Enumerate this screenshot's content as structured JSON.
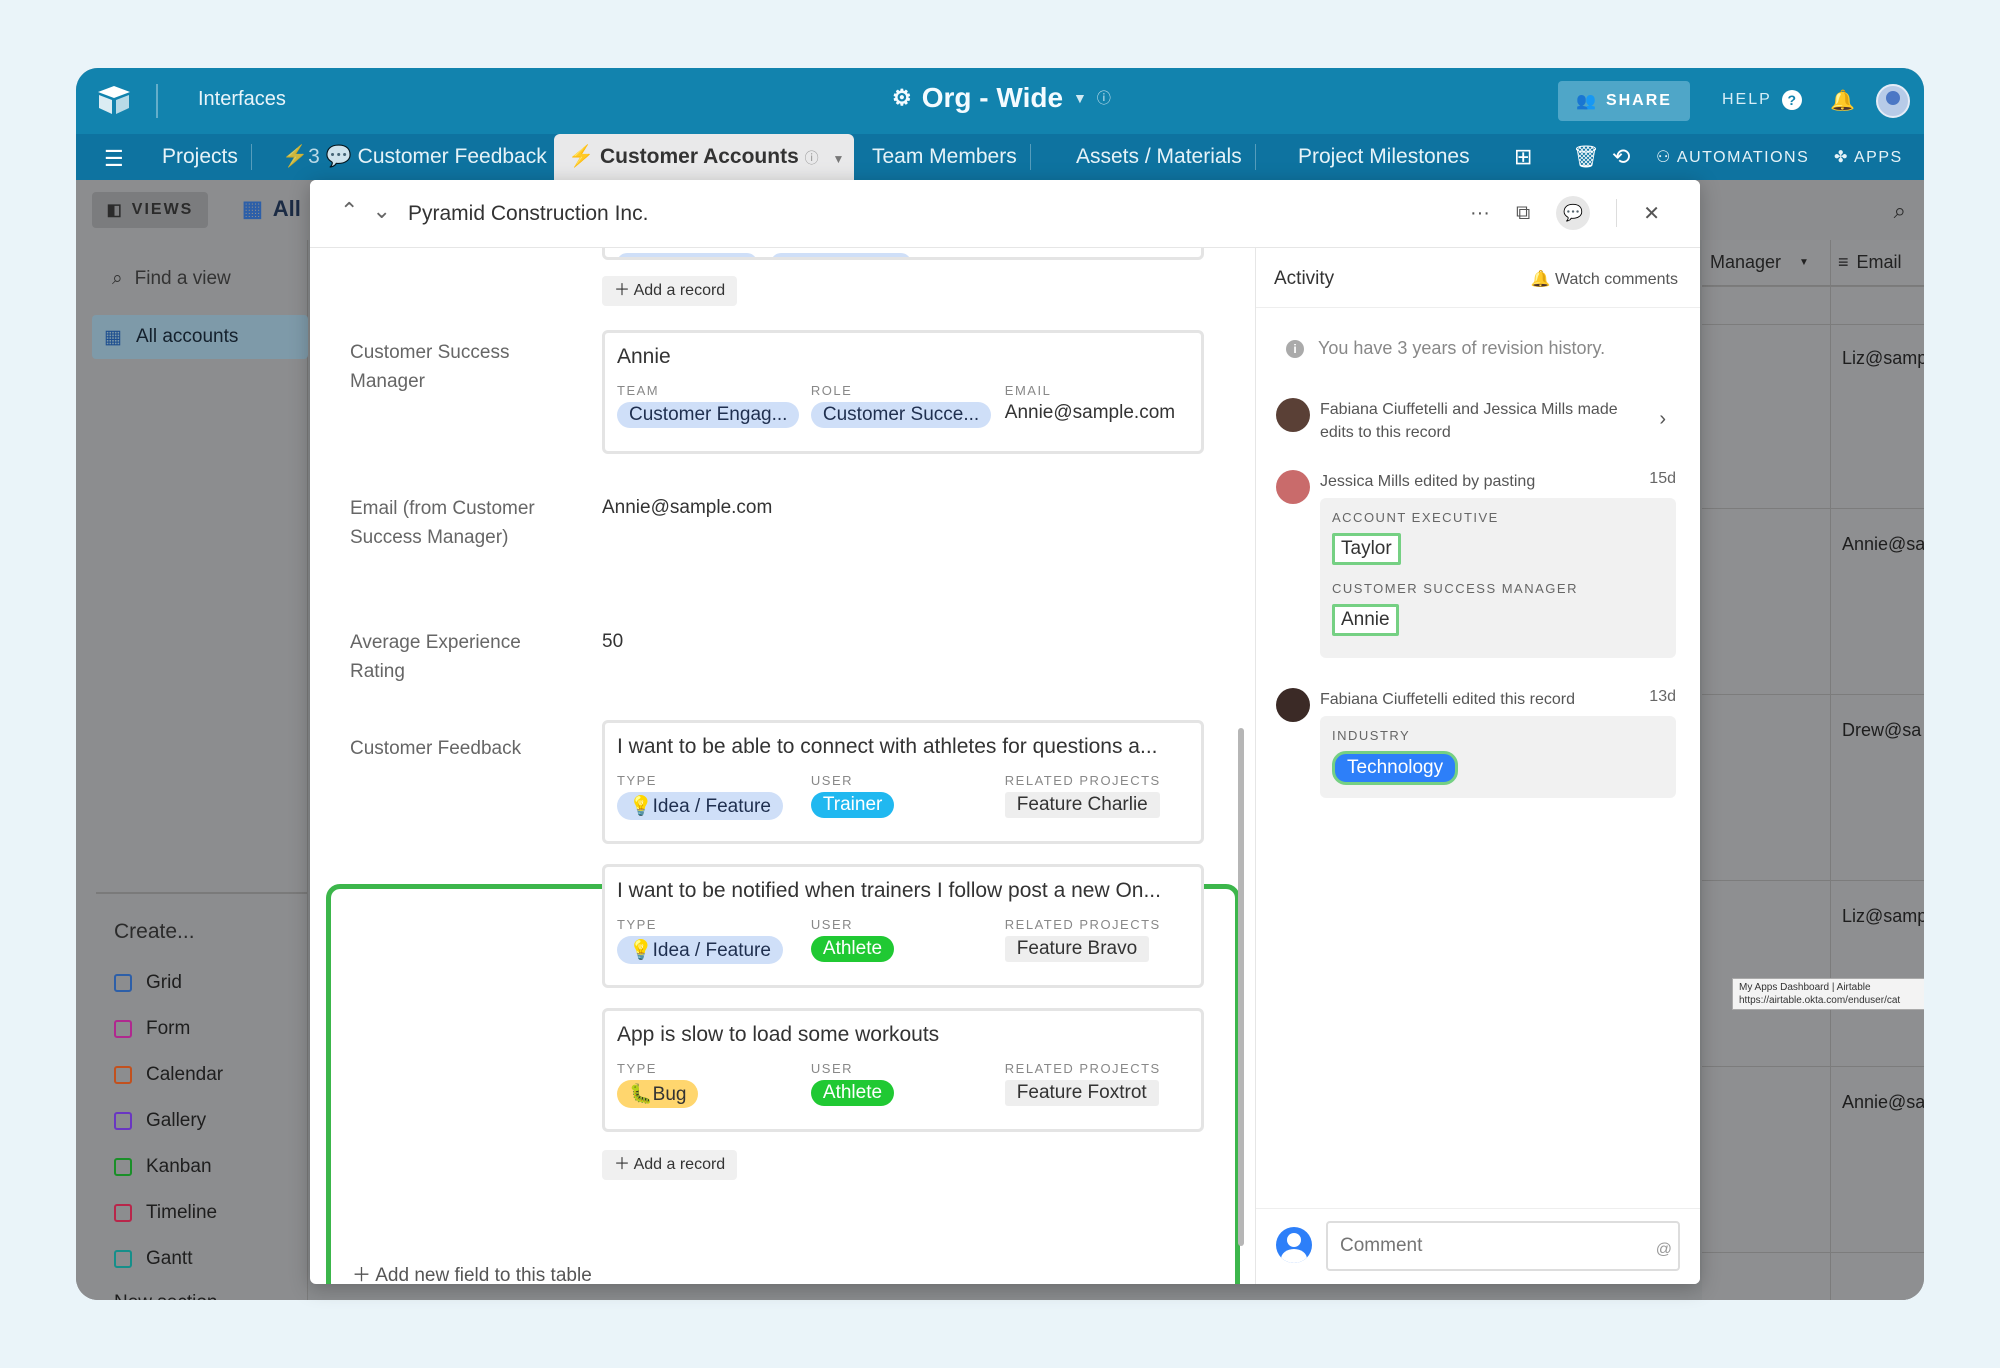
{
  "topbar": {
    "interfaces": "Interfaces",
    "base_name": "Org - Wide",
    "share": "SHARE",
    "help": "HELP"
  },
  "tabs": [
    {
      "label": "Projects"
    },
    {
      "label": "Customer Feedback",
      "prefix": "⚡3 💬"
    },
    {
      "label": "Customer Accounts"
    },
    {
      "label": "Team Members"
    },
    {
      "label": "Assets / Materials"
    },
    {
      "label": "Project Milestones"
    }
  ],
  "tabbar_right": {
    "automations": "AUTOMATIONS",
    "apps": "APPS"
  },
  "viewsbar": {
    "views": "VIEWS",
    "current_view_short": "All"
  },
  "sidebar": {
    "find_placeholder": "Find a view",
    "active_view": "All accounts",
    "create_label": "Create...",
    "create_items": [
      {
        "label": "Grid",
        "color": "#2d7ff9"
      },
      {
        "label": "Form",
        "color": "#e929ba"
      },
      {
        "label": "Calendar",
        "color": "#ff6f2c"
      },
      {
        "label": "Gallery",
        "color": "#8b46ff"
      },
      {
        "label": "Kanban",
        "color": "#20c933"
      },
      {
        "label": "Timeline",
        "color": "#f82b60"
      },
      {
        "label": "Gantt",
        "color": "#20d9d2"
      }
    ],
    "new_section": "New section"
  },
  "grid": {
    "col_manager": "Manager",
    "col_email": "Email",
    "emails": [
      "Liz@samp",
      "Annie@sa",
      "Drew@sa",
      "Liz@samp",
      "Annie@sa"
    ],
    "tooltip_line1": "My Apps Dashboard | Airtable",
    "tooltip_line2": "https://airtable.okta.com/enduser/cat"
  },
  "record": {
    "title": "Pyramid Construction Inc.",
    "add_record": "Add a record",
    "csm_label": "Customer Success Manager",
    "csm": {
      "name": "Annie",
      "team_label": "TEAM",
      "team": "Customer Engag...",
      "role_label": "ROLE",
      "role": "Customer Succe...",
      "email_label": "EMAIL",
      "email": "Annie@sample.com"
    },
    "email_from_label": "Email (from Customer Success Manager)",
    "email_from_value": "Annie@sample.com",
    "avg_label": "Average Experience Rating",
    "avg_value": "50",
    "feedback_label": "Customer Feedback",
    "feedback": [
      {
        "title": "I want to be able to connect with athletes for questions a...",
        "type": "💡Idea / Feature",
        "user": "Trainer",
        "user_color": "trainer",
        "project": "Feature Charlie"
      },
      {
        "title": "I want to be notified when trainers I follow post a new On...",
        "type": "💡Idea / Feature",
        "user": "Athlete",
        "user_color": "athlete",
        "project": "Feature Bravo"
      },
      {
        "title": "App is slow to load some workouts",
        "type": "🐛Bug",
        "user": "Athlete",
        "user_color": "athlete",
        "project": "Feature Foxtrot"
      }
    ],
    "col_type": "TYPE",
    "col_user": "USER",
    "col_projects": "RELATED PROJECTS",
    "add_field": "Add new field to this table"
  },
  "activity": {
    "title": "Activity",
    "watch": "Watch comments",
    "revision": "You have 3 years of revision history.",
    "group_line1": "Fabiana Ciuffetelli and Jessica Mills made",
    "group_line2": "edits to this record",
    "edit1_text": "Jessica Mills edited by pasting",
    "edit1_time": "15d",
    "edit1_label1": "ACCOUNT EXECUTIVE",
    "edit1_value1": "Taylor",
    "edit1_label2": "CUSTOMER SUCCESS MANAGER",
    "edit1_value2": "Annie",
    "edit2_text": "Fabiana Ciuffetelli edited this record",
    "edit2_time": "13d",
    "edit2_label": "INDUSTRY",
    "edit2_value": "Technology",
    "comment_placeholder": "Comment"
  }
}
